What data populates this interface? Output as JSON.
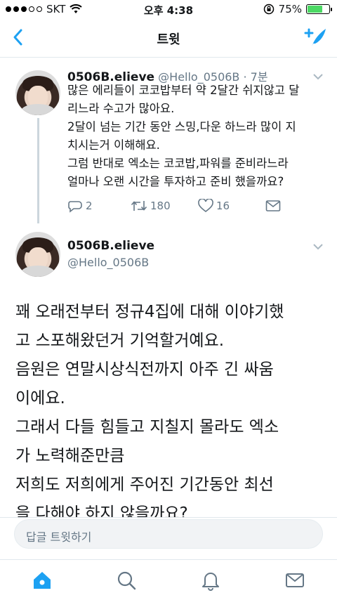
{
  "status_bar": {
    "carrier": "SKT",
    "time": "오후 4:38",
    "battery_percent": "75%",
    "battery_level": 0.75,
    "signal_dots": 3
  },
  "nav": {
    "title": "트윗",
    "back_icon": "chevron-left-icon",
    "compose_icon": "compose-feather-icon"
  },
  "parent_tweet": {
    "name": "0506B.elieve",
    "handle": "@Hello_0506B",
    "time": "· 7분",
    "text": "많은 에리들이 코코밥부터 약 2달간 쉬지않고 달\n리느라 수고가 많아요.\n2달이 넘는 기간 동안 스밍,다운 하느라 많이 지\n치시는거 이해해요.\n그럼 반대로 엑소는 코코밥,파워를 준비라느라\n얼마나 오랜 시간을 투자하고 준비 했을까요?",
    "replies": "2",
    "retweets": "180",
    "likes": "16"
  },
  "main_tweet": {
    "name": "0506B.elieve",
    "handle": "@Hello_0506B",
    "text": "꽤 오래전부터 정규4집에 대해 이야기했\n고 스포해왔던거 기억할거예요.\n음원은 연말시상식전까지 아주 긴 싸움\n이에요.\n그래서 다들 힘들고 지칠지 몰라도 엑소\n가 노력해준만큼\n저희도 저희에게 주어진 기간동안 최선\n을 다해야 하지 않을까요?"
  },
  "reply_bar": {
    "placeholder": "답글 트윗하기"
  },
  "tab_bar": {
    "items": [
      "home-icon",
      "search-icon",
      "notifications-icon",
      "messages-icon"
    ],
    "active": "home-icon"
  },
  "colors": {
    "accent": "#1da1f2",
    "muted": "#657786",
    "battery_green": "#4cd964"
  }
}
